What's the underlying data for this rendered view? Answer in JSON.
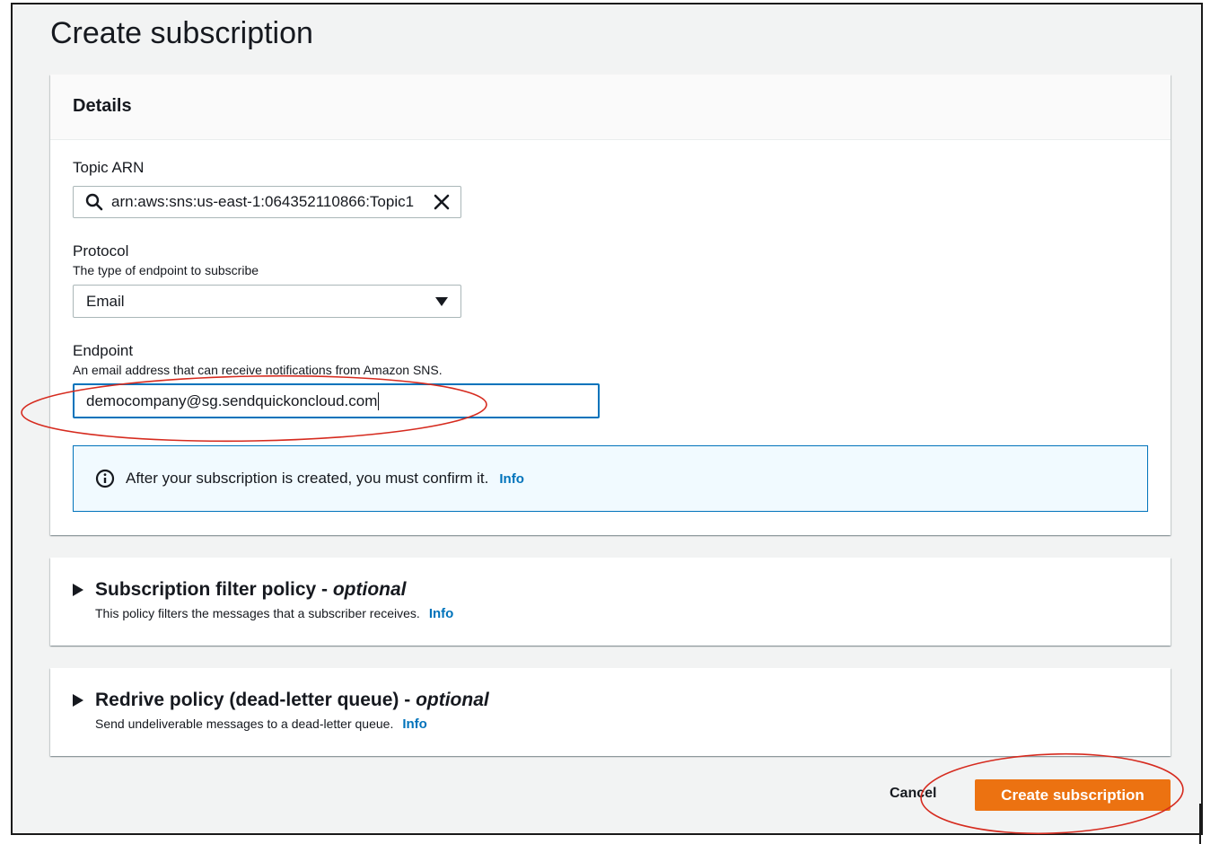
{
  "page": {
    "title": "Create subscription"
  },
  "details": {
    "heading": "Details",
    "topic_arn": {
      "label": "Topic ARN",
      "value": "arn:aws:sns:us-east-1:064352110866:Topic1"
    },
    "protocol": {
      "label": "Protocol",
      "description": "The type of endpoint to subscribe",
      "selected": "Email"
    },
    "endpoint": {
      "label": "Endpoint",
      "description": "An email address that can receive notifications from Amazon SNS.",
      "value": "democompany@sg.sendquickoncloud.com"
    },
    "alert": {
      "text": "After your subscription is created, you must confirm it.",
      "link": "Info"
    }
  },
  "filter_policy": {
    "title": "Subscription filter policy - ",
    "title_optional": "optional",
    "description": "This policy filters the messages that a subscriber receives.",
    "link": "Info"
  },
  "redrive_policy": {
    "title": "Redrive policy (dead-letter queue) - ",
    "title_optional": "optional",
    "description": "Send undeliverable messages to a dead-letter queue.",
    "link": "Info"
  },
  "actions": {
    "cancel_label": "Cancel",
    "create_label": "Create subscription"
  },
  "colors": {
    "primary_button": "#ec7211",
    "link": "#0073bb",
    "annotation": "#d62b1f"
  },
  "icons": [
    "search-icon",
    "clear-icon",
    "caret-down-icon",
    "info-circle-icon",
    "expand-triangle-icon"
  ]
}
